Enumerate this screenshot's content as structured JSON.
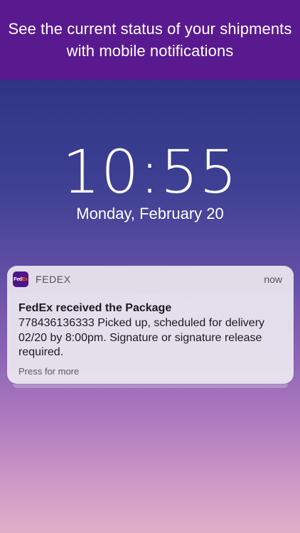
{
  "banner": {
    "text": "See the current status of your shipments with mobile notifications"
  },
  "lockscreen": {
    "time": "10:55",
    "date": "Monday, February 20"
  },
  "notification": {
    "app_icon": {
      "fed": "Fed",
      "ex": "Ex"
    },
    "app_name": "FEDEX",
    "time": "now",
    "title": "FedEx received the Package",
    "message": "778436136333 Picked up, scheduled for delivery 02/20 by 8:00pm. Signature or signature release required.",
    "more": "Press for more"
  },
  "colors": {
    "banner_bg": "#5a1a8f",
    "fedex_purple": "#4d148c",
    "fedex_orange": "#ff6600"
  }
}
